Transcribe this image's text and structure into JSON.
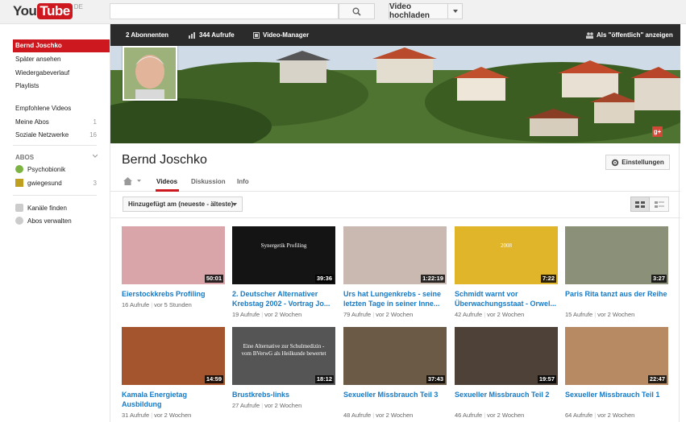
{
  "masthead": {
    "logo_you": "You",
    "logo_tube": "Tube",
    "logo_region": "DE",
    "search_placeholder": "",
    "upload_label": "Video hochladen"
  },
  "sidebar": {
    "items": [
      {
        "label": "Bernd Joschko",
        "active": true
      },
      {
        "label": "Später ansehen"
      },
      {
        "label": "Wiedergabeverlauf"
      },
      {
        "label": "Playlists"
      },
      {
        "label": "Empfohlene Videos"
      },
      {
        "label": "Meine Abos",
        "count": "1"
      },
      {
        "label": "Soziale Netzwerke",
        "count": "16"
      }
    ],
    "abos_heading": "ABOS",
    "subscriptions": [
      {
        "label": "Psychobionik",
        "count": ""
      },
      {
        "label": "gwiegesund",
        "count": "3"
      }
    ],
    "find_channels": "Kanäle finden",
    "manage_subs": "Abos verwalten"
  },
  "channel_bar": {
    "subscribers": "2 Abonnenten",
    "views": "344 Aufrufe",
    "video_manager": "Video-Manager",
    "view_as": "Als \"öffentlich\" anzeigen"
  },
  "channel": {
    "name": "Bernd Joschko",
    "settings_label": "Einstellungen",
    "tabs": [
      "Videos",
      "Diskussion",
      "Info"
    ],
    "sort_label": "Hinzugefügt am (neueste - älteste)"
  },
  "videos": [
    {
      "title": "Eierstockkrebs Profiling",
      "views": "16 Aufrufe",
      "age": "vor 5 Stunden",
      "duration": "50:01",
      "thumb": "#d9a5a8"
    },
    {
      "title": "2. Deutscher Alternativer Krebstag 2002 - Vortrag Jo...",
      "views": "19 Aufrufe",
      "age": "vor 2 Wochen",
      "duration": "39:36",
      "thumb": "#141414",
      "overlay": "Synergetik Profiling"
    },
    {
      "title": "Urs hat Lungenkrebs - seine letzten Tage in seiner Inne...",
      "views": "79 Aufrufe",
      "age": "vor 2 Wochen",
      "duration": "1:22:19",
      "thumb": "#c9b9b0"
    },
    {
      "title": "Schmidt warnt vor Überwachungsstaat - Orwel...",
      "views": "42 Aufrufe",
      "age": "vor 2 Wochen",
      "duration": "7:22",
      "thumb": "#e0b52a",
      "overlay": "2008"
    },
    {
      "title": "Paris Rita tanzt aus der Reihe",
      "views": "15 Aufrufe",
      "age": "vor 2 Wochen",
      "duration": "3:27",
      "thumb": "#8b9078"
    },
    {
      "title": "Kamala Energietag Ausbildung",
      "views": "31 Aufrufe",
      "age": "vor 2 Wochen",
      "duration": "14:59",
      "thumb": "#a4552e"
    },
    {
      "title": "Brustkrebs-links",
      "views": "27 Aufrufe",
      "age": "vor 2 Wochen",
      "duration": "18:12",
      "thumb": "#555555",
      "overlay": "Eine Alternative zur Schulmedizin - vom BVerwG als Heilkunde bewertet"
    },
    {
      "title": "Sexueller Missbrauch Teil 3",
      "views": "48 Aufrufe",
      "age": "vor 2 Wochen",
      "duration": "37:43",
      "thumb": "#6a5a46"
    },
    {
      "title": "Sexueller Missbrauch Teil 2",
      "views": "46 Aufrufe",
      "age": "vor 2 Wochen",
      "duration": "19:57",
      "thumb": "#4e4137"
    },
    {
      "title": "Sexueller Missbrauch Teil 1",
      "views": "64 Aufrufe",
      "age": "vor 2 Wochen",
      "duration": "22:47",
      "thumb": "#b78a63"
    }
  ],
  "colors": {
    "brand_red": "#cc181e",
    "link_blue": "#167ac6",
    "dark_bar": "#2b2b2b"
  }
}
